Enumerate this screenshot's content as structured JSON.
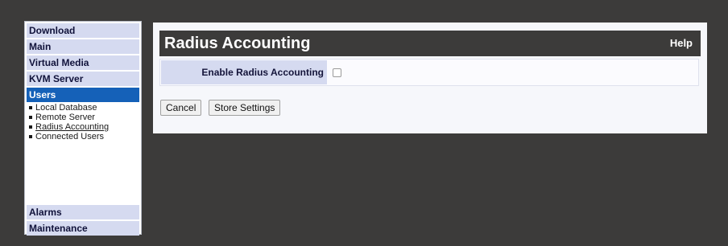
{
  "sidebar": {
    "items": [
      {
        "label": "Download"
      },
      {
        "label": "Main"
      },
      {
        "label": "Virtual Media"
      },
      {
        "label": "KVM Server"
      },
      {
        "label": "Users"
      }
    ],
    "submenu": [
      {
        "label": "Local Database"
      },
      {
        "label": "Remote Server"
      },
      {
        "label": "Radius Accounting"
      },
      {
        "label": "Connected Users"
      }
    ],
    "bottom_items": [
      {
        "label": "Alarms"
      },
      {
        "label": "Maintenance"
      }
    ]
  },
  "main": {
    "title": "Radius Accounting",
    "help": "Help",
    "field_label": "Enable Radius Accounting",
    "field_checked": false,
    "cancel_label": "Cancel",
    "store_label": "Store Settings"
  },
  "colors": {
    "background": "#3c3b3a",
    "nav_bg": "#d5daf0",
    "nav_active": "#1561b8",
    "panel_bg": "#f6f7fb"
  }
}
